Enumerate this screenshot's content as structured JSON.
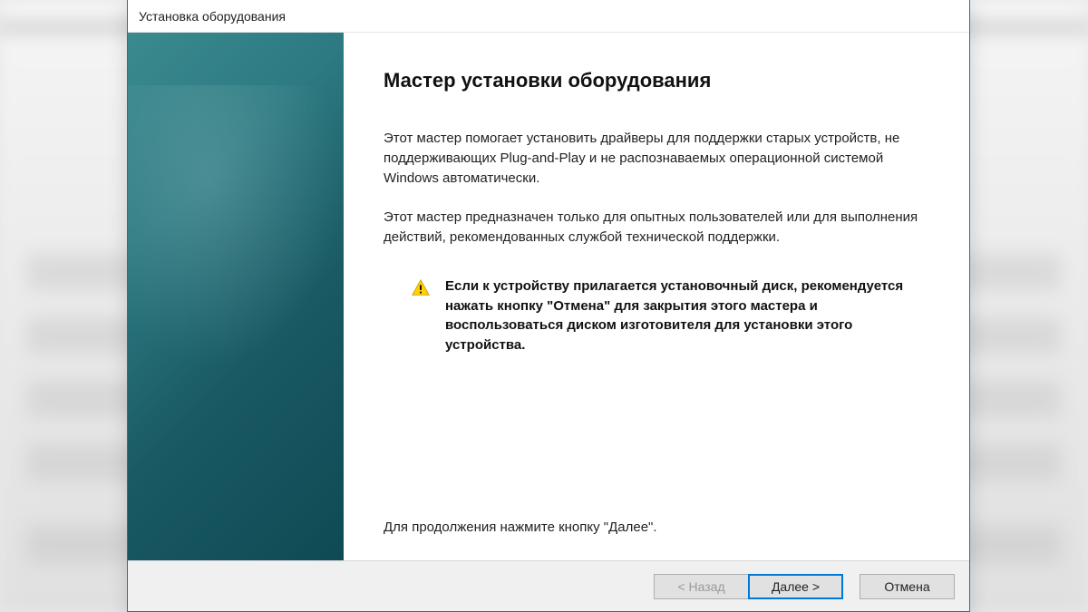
{
  "window": {
    "title": "Установка оборудования"
  },
  "wizard": {
    "heading": "Мастер установки оборудования",
    "para1": "Этот мастер помогает установить драйверы для поддержки старых устройств, не поддерживающих Plug-and-Play и не распознаваемых операционной системой Windows автоматически.",
    "para2": "Этот мастер предназначен только для опытных пользователей или для выполнения действий, рекомендованных службой технической поддержки.",
    "warning": "Если к устройству прилагается установочный диск, рекомендуется нажать кнопку \"Отмена\" для закрытия этого мастера и воспользоваться диском изготовителя для установки этого устройства.",
    "continue_hint": "Для продолжения нажмите кнопку \"Далее\"."
  },
  "buttons": {
    "back": "< Назад",
    "next": "Далее >",
    "cancel": "Отмена"
  }
}
